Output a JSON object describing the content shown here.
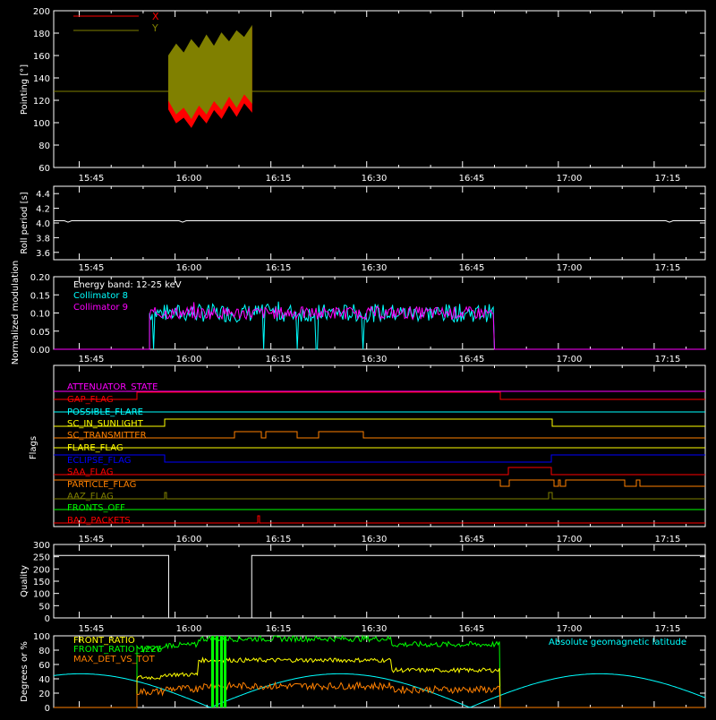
{
  "time_ticks": [
    "15:45",
    "16:00",
    "16:15",
    "16:30",
    "16:45",
    "17:00",
    "17:15"
  ],
  "chart_data": [
    {
      "type": "line",
      "ylabel": "Pointing [°]",
      "ylim": [
        60,
        200
      ],
      "yticks": [
        "60",
        "80",
        "100",
        "120",
        "140",
        "160",
        "180",
        "200"
      ],
      "legend": [
        {
          "name": "X",
          "color": "#ff0000"
        },
        {
          "name": "Y",
          "color": "#808000"
        }
      ],
      "x_range": [
        "15:59",
        "16:12"
      ],
      "x_series": {
        "name": "X",
        "lower": [
          112,
          100,
          105,
          96,
          108,
          100,
          112,
          104,
          116,
          106,
          118,
          110
        ],
        "upper": [
          158,
          168,
          160,
          172,
          164,
          176,
          166,
          178,
          170,
          180,
          174,
          184
        ]
      },
      "y_series": {
        "name": "Y",
        "lower": [
          120,
          108,
          114,
          104,
          116,
          108,
          120,
          112,
          124,
          114,
          126,
          118
        ],
        "upper": [
          160,
          170,
          162,
          174,
          166,
          178,
          168,
          180,
          172,
          182,
          176,
          186
        ]
      },
      "reference_line": 128
    },
    {
      "type": "line",
      "ylabel": "Roll period [s]",
      "ylim": [
        3.5,
        4.5
      ],
      "yticks": [
        "3.6",
        "3.8",
        "4.0",
        "4.2",
        "4.4"
      ],
      "series": [
        {
          "color": "#ffffff",
          "value": 4.03
        }
      ]
    },
    {
      "type": "line",
      "ylabel": "Normalized modulation",
      "ylim": [
        0,
        0.2
      ],
      "yticks": [
        "0.00",
        "0.05",
        "0.10",
        "0.15",
        "0.20"
      ],
      "annotation": "Energy band: 12-25 keV",
      "legend": [
        {
          "name": "Collimator 8",
          "color": "#00ffff"
        },
        {
          "name": "Collimator 9",
          "color": "#ff00ff"
        }
      ],
      "x_range": [
        "15:56",
        "16:50"
      ],
      "mean_value": 0.1
    },
    {
      "type": "line",
      "ylabel": "Flags",
      "flags": [
        {
          "name": "ATTENUATOR_STATE",
          "color": "#ff00ff"
        },
        {
          "name": "GAP_FLAG",
          "color": "#ff0000"
        },
        {
          "name": "POSSIBLE_FLARE",
          "color": "#00ffff"
        },
        {
          "name": "SC_IN_SUNLIGHT",
          "color": "#ffff00"
        },
        {
          "name": "SC_TRANSMITTER",
          "color": "#ff8000"
        },
        {
          "name": "FLARE_FLAG",
          "color": "#ffff00"
        },
        {
          "name": "ECLIPSE_FLAG",
          "color": "#0000ff"
        },
        {
          "name": "SAA_FLAG",
          "color": "#ff0000"
        },
        {
          "name": "PARTICLE_FLAG",
          "color": "#ff8000"
        },
        {
          "name": "AAZ_FLAG",
          "color": "#808000"
        },
        {
          "name": "FRONTS_OFF",
          "color": "#00ff00"
        },
        {
          "name": "BAD_PACKETS",
          "color": "#ff0000"
        }
      ]
    },
    {
      "type": "line",
      "ylabel": "Quality",
      "ylim": [
        0,
        300
      ],
      "yticks": [
        "0",
        "50",
        "100",
        "150",
        "200",
        "250",
        "300"
      ],
      "series": [
        {
          "color": "#ffffff",
          "segments": [
            [
              "15:41",
              "15:59",
              255
            ],
            [
              "16:12",
              "17:23",
              255
            ]
          ]
        }
      ]
    },
    {
      "type": "line",
      "ylabel": "Degrees or %",
      "ylim": [
        0,
        100
      ],
      "yticks": [
        "0",
        "20",
        "40",
        "60",
        "80",
        "100"
      ],
      "legend": [
        {
          "name": "FRONT_RATIO",
          "color": "#ffff00"
        },
        {
          "name": "FRONT_RATIO_1226",
          "color": "#00ff00"
        },
        {
          "name": "MAX_DET_VS_TOT",
          "color": "#ff8000"
        }
      ],
      "right_label": {
        "name": "Absolute geomagnetic latitude",
        "color": "#00ffff"
      }
    }
  ]
}
